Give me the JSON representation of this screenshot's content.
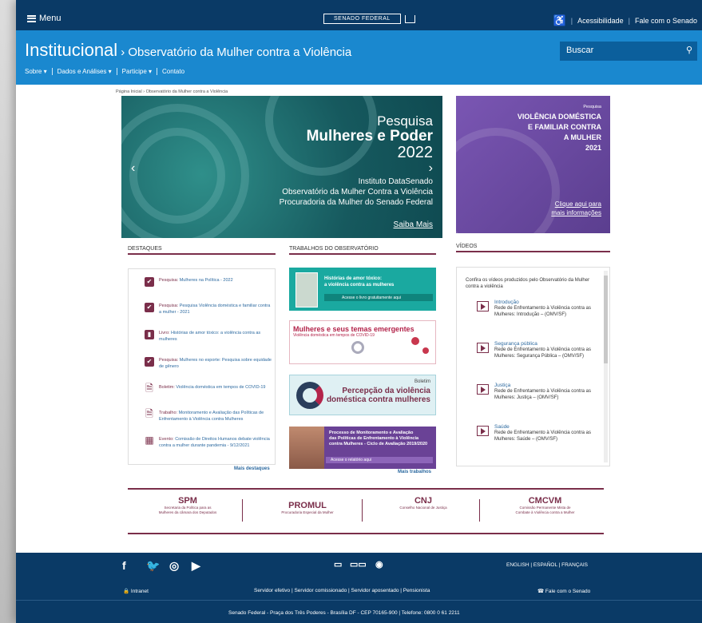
{
  "topbar": {
    "menu_label": "Menu",
    "logo_text": "SENADO FEDERAL",
    "accessibility": "Acessibilidade",
    "contact": "Fale com o Senado"
  },
  "header": {
    "title_main": "Institucional",
    "title_sub": "› Observatório da Mulher contra a Violência",
    "search_placeholder": "Buscar",
    "nav": [
      "Sobre ▾",
      "Dados e Análises ▾",
      "Participe ▾",
      "Contato"
    ]
  },
  "breadcrumb": "Página Inicial  ›  Observatório da Mulher contra a Violência",
  "hero": {
    "line1": "Pesquisa",
    "line2": "Mulheres e Poder",
    "line3": "2022",
    "credits": [
      "Instituto DataSenado",
      "Observatório da Mulher Contra a Violência",
      "Procuradoria da Mulher do Senado Federal"
    ],
    "cta": "Saiba Mais"
  },
  "side_banner": {
    "small": "Pesquisa",
    "title": [
      "VIOLÊNCIA DOMÉSTICA",
      "E FAMILIAR CONTRA",
      "A MULHER",
      "2021"
    ],
    "link": [
      "Clique aqui para",
      "mais informações"
    ]
  },
  "columns": {
    "destaques": "DESTAQUES",
    "trabalhos": "TRABALHOS DO OBSERVATÓRIO",
    "videos": "VÍDEOS"
  },
  "destaques": [
    {
      "type": "Pesquisa:",
      "text": "Mulheres na Política - 2022"
    },
    {
      "type": "Pesquisa:",
      "text": "Pesquisa Violência doméstica e familiar contra a mulher - 2021"
    },
    {
      "type": "Livro:",
      "text": "Histórias de amor tóxico: a violência contra as mulheres"
    },
    {
      "type": "Pesquisa:",
      "text": "Mulheres no esporte: Pesquisa sobre equidade de gênero"
    },
    {
      "type": "Boletim:",
      "text": "Violência doméstica em tempos de COVID-19"
    },
    {
      "type": "Trabalho:",
      "text": "Monitoramento e Avaliação das Políticas de Enfrentamento à Violência contra Mulheres"
    },
    {
      "type": "Evento:",
      "text": "Comissão de Direitos Humanos debate violência contra a mulher durante pandemia - 9/12/2021"
    }
  ],
  "destaques_more": "Mais destaques",
  "trabalhos": {
    "b1_title": [
      "Histórias de amor tóxico:",
      "a violência contra as mulheres"
    ],
    "b1_cta": "Acesse o livro gratuitamente aqui",
    "b2_title": "Mulheres e seus temas emergentes",
    "b2_sub": "Violência doméstica em tempos de COVID-19",
    "b3_label": "Boletim",
    "b3_title": [
      "Percepção da violência",
      "doméstica contra mulheres"
    ],
    "b4_title": [
      "Processo de Monitoramento e Avaliação",
      "das Políticas de Enfrentamento à Violência",
      "contra Mulheres - Ciclo de Avaliação 2019/2020"
    ],
    "b4_cta": "Acesse o relatório aqui",
    "more": "Mais trabalhos"
  },
  "videos": {
    "intro": "Confira os vídeos produzidos pelo Observatório da Mulher contra a violência",
    "items": [
      {
        "title": "Introdução",
        "desc": "Rede de Enfrentamento à Violência contra as Mulheres: Introdução – (OMV/SF)"
      },
      {
        "title": "Segurança pública",
        "desc": "Rede de Enfrentamento à Violência contra as Mulheres: Segurança Pública – (OMV/SF)"
      },
      {
        "title": "Justiça",
        "desc": "Rede de Enfrentamento à Violência contra as Mulheres: Justiça – (OMV/SF)"
      },
      {
        "title": "Saúde",
        "desc": "Rede de Enfrentamento à Violência contra as Mulheres: Saúde – (OMV/SF)"
      }
    ]
  },
  "partners": [
    {
      "abbr": "SPM",
      "name": [
        "Secretaria da Política para as",
        "Mulheres da câmara dos Deputados"
      ]
    },
    {
      "abbr": "PROMUL",
      "name": [
        "Procuradoria Especial da Mulher"
      ]
    },
    {
      "abbr": "CNJ",
      "name": [
        "Conselho Nacional de Justiça"
      ]
    },
    {
      "abbr": "CMCVM",
      "name": [
        "Comissão Permanente Mista de",
        "Combate à Violência contra a Mulher"
      ]
    }
  ],
  "footer": {
    "languages": "ENGLISH  |  ESPAÑOL  |  FRANÇAIS",
    "intranet": "Intranet",
    "links": "Servidor efetivo  |  Servidor comissionado  |  Servidor aposentado  |  Pensionista",
    "contact": "Fale com o Senado",
    "address": "Senado Federal - Praça dos Três Poderes - Brasília DF - CEP 70165-900 | Telefone: 0800 0 61 2211"
  }
}
